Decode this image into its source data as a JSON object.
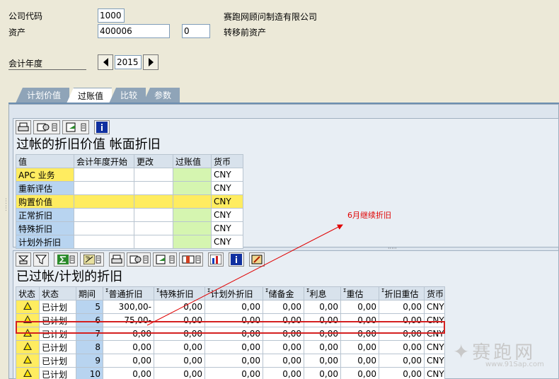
{
  "header": {
    "company_code_label": "公司代码",
    "company_code_value": "1000",
    "company_name": "赛跑网顾问制造有限公司",
    "asset_label": "资产",
    "asset_value": "400006",
    "asset_sub_value": "0",
    "asset_desc": "转移前资产",
    "fiscal_year_label": "会计年度",
    "fiscal_year_value": "2015"
  },
  "tabs": [
    {
      "label": "计划价值",
      "active": false
    },
    {
      "label": "过账值",
      "active": true
    },
    {
      "label": "比较",
      "active": false
    },
    {
      "label": "参数",
      "active": false
    }
  ],
  "upper": {
    "title": "过帐的折旧价值 帐面折旧",
    "columns": [
      "值",
      "会计年度开始",
      "更改",
      "过账值",
      "货币"
    ],
    "rows": [
      {
        "name": "APC 业务",
        "currency": "CNY"
      },
      {
        "name": "重新评估",
        "currency": "CNY"
      },
      {
        "name": "购置价值",
        "currency": "CNY"
      },
      {
        "name": "正常折旧",
        "currency": "CNY"
      },
      {
        "name": "特殊折旧",
        "currency": "CNY"
      },
      {
        "name": "计划外折旧",
        "currency": "CNY"
      }
    ]
  },
  "lower": {
    "title": "已过帐/计划的折旧",
    "columns": [
      "状态",
      "状态",
      "期间",
      "普通折旧",
      "特殊折旧",
      "计划外折旧",
      "储备金",
      "利息",
      "重估",
      "折旧重估",
      "货币"
    ],
    "rows": [
      {
        "status": "已计划",
        "period": "5",
        "ordinary": "300,00-",
        "special": "0,00",
        "unplanned": "0,00",
        "reserve": "0,00",
        "interest": "0,00",
        "reval": "0,00",
        "dep_reval": "0,00",
        "currency": "CNY"
      },
      {
        "status": "已计划",
        "period": "6",
        "ordinary": "75,00-",
        "special": "0,00",
        "unplanned": "0,00",
        "reserve": "0,00",
        "interest": "0,00",
        "reval": "0,00",
        "dep_reval": "0,00",
        "currency": "CNY"
      },
      {
        "status": "已计划",
        "period": "7",
        "ordinary": "0,00",
        "special": "0,00",
        "unplanned": "0,00",
        "reserve": "0,00",
        "interest": "0,00",
        "reval": "0,00",
        "dep_reval": "0,00",
        "currency": "CNY"
      },
      {
        "status": "已计划",
        "period": "8",
        "ordinary": "0,00",
        "special": "0,00",
        "unplanned": "0,00",
        "reserve": "0,00",
        "interest": "0,00",
        "reval": "0,00",
        "dep_reval": "0,00",
        "currency": "CNY"
      },
      {
        "status": "已计划",
        "period": "9",
        "ordinary": "0,00",
        "special": "0,00",
        "unplanned": "0,00",
        "reserve": "0,00",
        "interest": "0,00",
        "reval": "0,00",
        "dep_reval": "0,00",
        "currency": "CNY"
      },
      {
        "status": "已计划",
        "period": "10",
        "ordinary": "0,00",
        "special": "0,00",
        "unplanned": "0,00",
        "reserve": "0,00",
        "interest": "0,00",
        "reval": "0,00",
        "dep_reval": "0,00",
        "currency": "CNY"
      }
    ]
  },
  "annotation": "6月继续折旧",
  "watermark": {
    "text": "赛跑网",
    "url": "www.91Sap.com"
  },
  "colors": {
    "accent": "#6c8eb0",
    "annotation": "#e00000",
    "highlight": "#ffec60"
  }
}
